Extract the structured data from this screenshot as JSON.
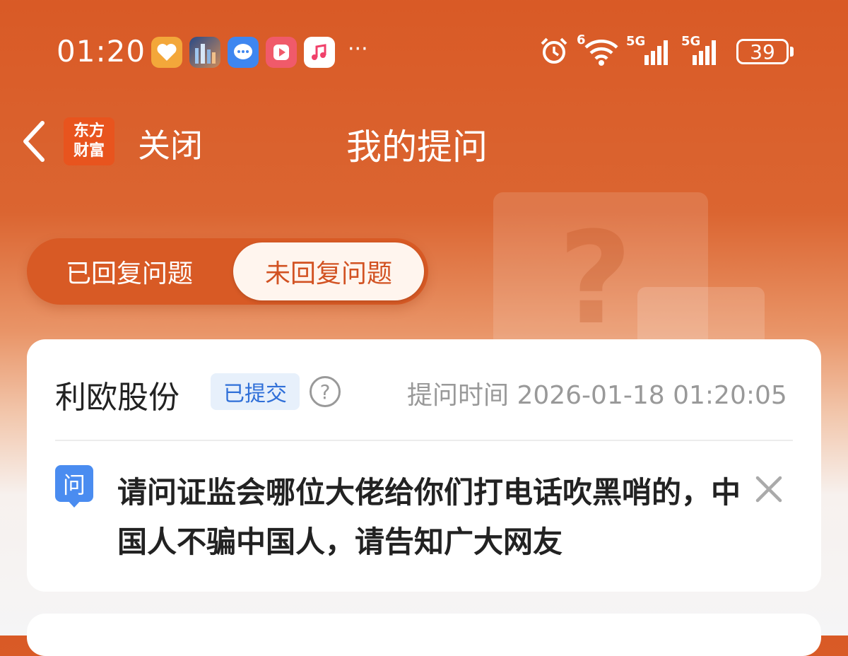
{
  "status_bar": {
    "time": "01:20",
    "notification_icons": [
      "health-icon",
      "photo-icon",
      "message-icon",
      "video-icon",
      "music-icon"
    ],
    "more": "···",
    "alarm": "alarm-icon",
    "wifi_label": "6",
    "signal1_label": "5G",
    "signal2_label": "5G",
    "battery": "39"
  },
  "nav": {
    "logo_line1": "东方",
    "logo_line2": "财富",
    "close": "关闭",
    "title": "我的提问"
  },
  "tabs": {
    "answered": "已回复问题",
    "unanswered": "未回复问题",
    "active": "unanswered"
  },
  "question_card": {
    "company": "利欧股份",
    "status": "已提交",
    "help": "?",
    "time_label": "提问时间 2026-01-18 01:20:05",
    "q_icon": "问",
    "question": "请问证监会哪位大佬给你们打电话吹黑哨的，中国人不骗中国人，请告知广大网友"
  },
  "colors": {
    "accent": "#d95a26",
    "badge_bg": "#e7f0fb",
    "badge_text": "#2f6fd8",
    "q_icon": "#4a8cf0"
  }
}
